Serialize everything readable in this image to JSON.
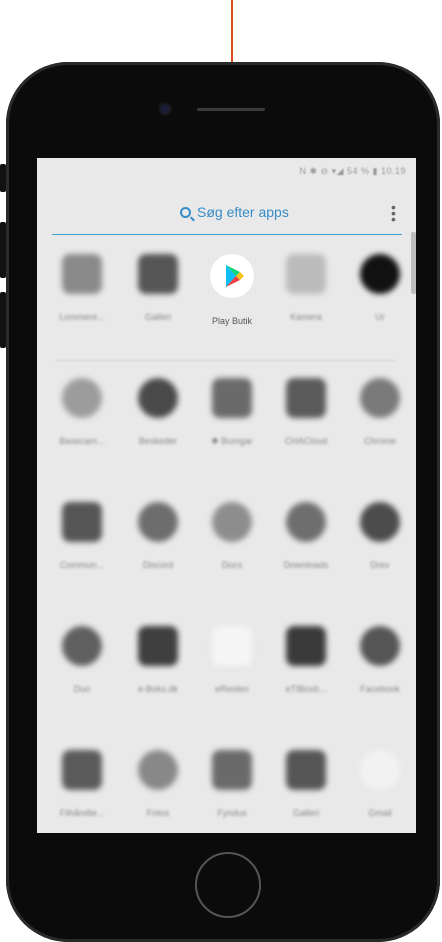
{
  "status_bar": "N ✱ ⊖ ▾◢ 54 % ▮ 10.19",
  "search": {
    "placeholder": "Søg efter apps"
  },
  "rows": [
    [
      {
        "label": "Lommere...",
        "icon": "calculator-icon",
        "color": "#8a8a8a"
      },
      {
        "label": "Galleri",
        "icon": "gallery-icon",
        "color": "#555555"
      },
      {
        "label": "Play Butik",
        "icon": "play-store-icon",
        "color": "#ffffff"
      },
      {
        "label": "Kamera",
        "icon": "camera-icon",
        "color": "#bbbbbb"
      },
      {
        "label": "Ur",
        "icon": "clock-icon",
        "color": "#111111"
      }
    ],
    [
      {
        "label": "Basecam...",
        "icon": "basecamp-icon",
        "color": "#9c9c9c"
      },
      {
        "label": "Beskeder",
        "icon": "messages-icon",
        "color": "#4a4a4a"
      },
      {
        "label": "✱ Bumgar",
        "icon": "bumgar-icon",
        "color": "#6a6a6a"
      },
      {
        "label": "CHACloud",
        "icon": "cloud-icon",
        "color": "#5a5a5a"
      },
      {
        "label": "Chrome",
        "icon": "chrome-icon",
        "color": "#7a7a7a"
      }
    ],
    [
      {
        "label": "Commun...",
        "icon": "community-icon",
        "color": "#555555"
      },
      {
        "label": "Discord",
        "icon": "discord-icon",
        "color": "#6d6d6d"
      },
      {
        "label": "Docs",
        "icon": "docs-icon",
        "color": "#8d8d8d"
      },
      {
        "label": "Downloads",
        "icon": "downloads-icon",
        "color": "#6e6e6e"
      },
      {
        "label": "Drev",
        "icon": "drive-icon",
        "color": "#4c4c4c"
      }
    ],
    [
      {
        "label": "Duo",
        "icon": "duo-icon",
        "color": "#5f5f5f"
      },
      {
        "label": "e-Boks.dk",
        "icon": "eboks-icon",
        "color": "#3f3f3f"
      },
      {
        "label": "eReolen",
        "icon": "ereolen-icon",
        "color": "#f5f5f5"
      },
      {
        "label": "eTIBoxb...",
        "icon": "etibox-icon",
        "color": "#3a3a3a"
      },
      {
        "label": "Facebook",
        "icon": "facebook-icon",
        "color": "#555555"
      }
    ],
    [
      {
        "label": "Filhåndte...",
        "icon": "file-manager-icon",
        "color": "#5a5a5a"
      },
      {
        "label": "Fotos",
        "icon": "photos-icon",
        "color": "#888888"
      },
      {
        "label": "Fyndus",
        "icon": "fyndus-icon",
        "color": "#6a6a6a"
      },
      {
        "label": "Galleri",
        "icon": "gallery-icon",
        "color": "#555555"
      },
      {
        "label": "Gmail",
        "icon": "gmail-icon",
        "color": "#f2f2f2"
      }
    ]
  ]
}
